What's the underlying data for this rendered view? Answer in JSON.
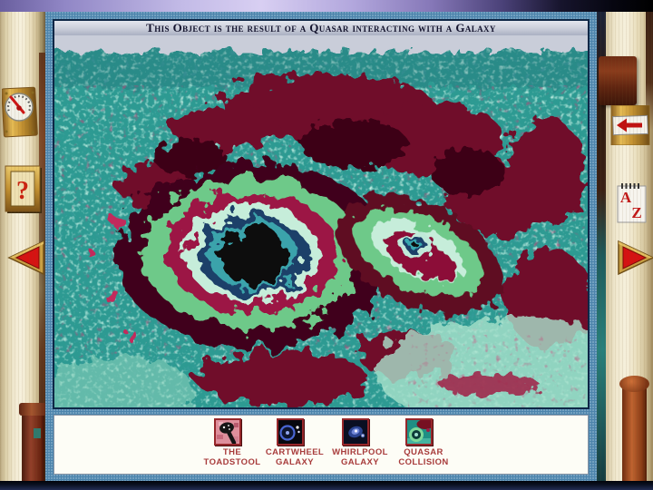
{
  "caption": "This Object is the result of a Quasar interacting with a Galaxy",
  "icons": {
    "help_glyph": "?",
    "az_a": "A",
    "az_z": "Z"
  },
  "thumbnails": [
    {
      "line1": "THE",
      "line2": "TOADSTOOL"
    },
    {
      "line1": "CARTWHEEL",
      "line2": "GALAXY"
    },
    {
      "line1": "WHIRLPOOL",
      "line2": "GALAXY"
    },
    {
      "line1": "QUASAR",
      "line2": "COLLISION"
    }
  ],
  "colors": {
    "frame_steel": "#4c84ac",
    "frame_navy": "#0e2746",
    "caption_text": "#14142e",
    "label_maroon": "#a83c3c",
    "wood_parchment": "#f2ead2",
    "gold": "#cf9f3d",
    "arrow_red": "#d61212",
    "image_teal": "#2d9a92",
    "top_bar_purple": "#c3bbe7",
    "bottom_bar_navy": "#1a2342"
  }
}
